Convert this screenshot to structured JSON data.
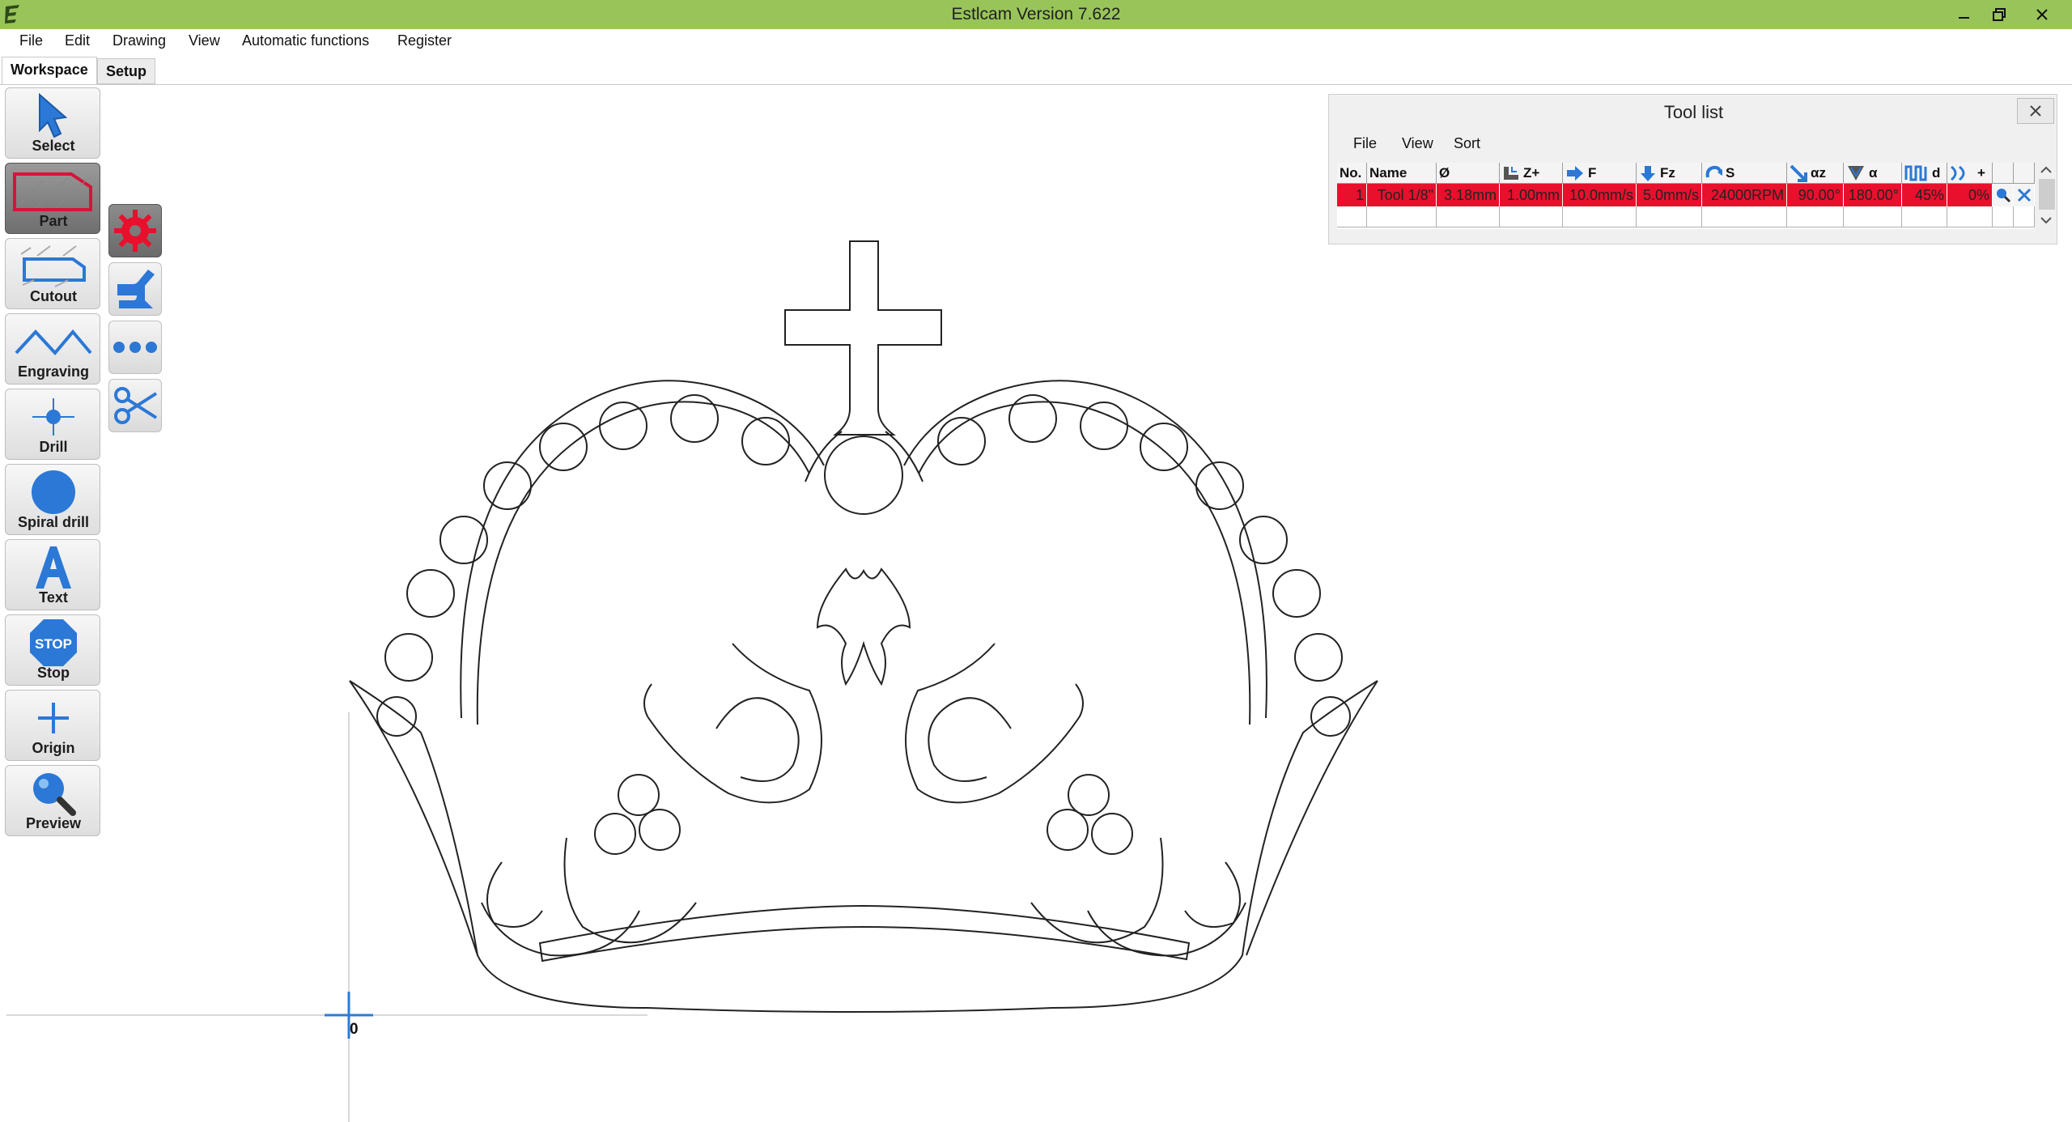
{
  "window": {
    "title": "Estlcam Version 7.622",
    "accent_color": "#99c45a",
    "controls": [
      "minimize-icon",
      "restore-icon",
      "close-icon"
    ]
  },
  "menu": [
    "File",
    "Edit",
    "Drawing",
    "View",
    "Automatic functions",
    "Register"
  ],
  "tabs": [
    {
      "label": "Workspace",
      "active": true
    },
    {
      "label": "Setup",
      "active": false
    }
  ],
  "toolbar": [
    {
      "label": "Select",
      "icon": "cursor-arrow-icon"
    },
    {
      "label": "Part",
      "icon": "part-outline-icon",
      "active": true
    },
    {
      "label": "Cutout",
      "icon": "cutout-icon"
    },
    {
      "label": "Engraving",
      "icon": "engraving-zigzag-icon"
    },
    {
      "label": "Drill",
      "icon": "drill-crosshair-icon"
    },
    {
      "label": "Spiral drill",
      "icon": "spiral-drill-circle-icon"
    },
    {
      "label": "Text",
      "icon": "text-a-icon"
    },
    {
      "label": "Stop",
      "icon": "stop-sign-icon",
      "icon_text": "STOP"
    },
    {
      "label": "Origin",
      "icon": "origin-plus-icon"
    },
    {
      "label": "Preview",
      "icon": "magnifier-icon"
    }
  ],
  "subtoolbar": [
    {
      "name": "settings-gear-icon",
      "active": true
    },
    {
      "name": "toolpath-join-icon"
    },
    {
      "name": "more-dots-icon"
    },
    {
      "name": "scissors-icon"
    }
  ],
  "canvas": {
    "origin_label": "0"
  },
  "tool_list": {
    "title": "Tool list",
    "menu": [
      "File",
      "View",
      "Sort"
    ],
    "columns": [
      {
        "label": "No.",
        "icon": null
      },
      {
        "label": "Name",
        "icon": null
      },
      {
        "label": "Ø",
        "icon": null
      },
      {
        "label": "Z+",
        "icon": "depth-step-icon"
      },
      {
        "label": "F",
        "icon": "feed-arrow-right-icon"
      },
      {
        "label": "Fz",
        "icon": "plunge-arrow-down-icon"
      },
      {
        "label": "S",
        "icon": "spindle-rotate-icon"
      },
      {
        "label": "αz",
        "icon": "ramp-angle-icon"
      },
      {
        "label": "α",
        "icon": "tool-angle-icon"
      },
      {
        "label": "d",
        "icon": "stepover-icon"
      },
      {
        "label": "+",
        "icon": "offset-icon"
      },
      {
        "label": "",
        "icon": null
      },
      {
        "label": "",
        "icon": null
      }
    ],
    "rows": [
      {
        "cells": [
          "1",
          "Tool 1/8\"",
          "3.18mm",
          "1.00mm",
          "10.0mm/s",
          "5.0mm/s",
          "24000RPM",
          "90.00°",
          "180.00°",
          "45%",
          "0%"
        ],
        "actions": [
          "edit-magnifier-icon",
          "delete-tool-icon"
        ],
        "highlight_color": "#e8102d"
      }
    ]
  }
}
